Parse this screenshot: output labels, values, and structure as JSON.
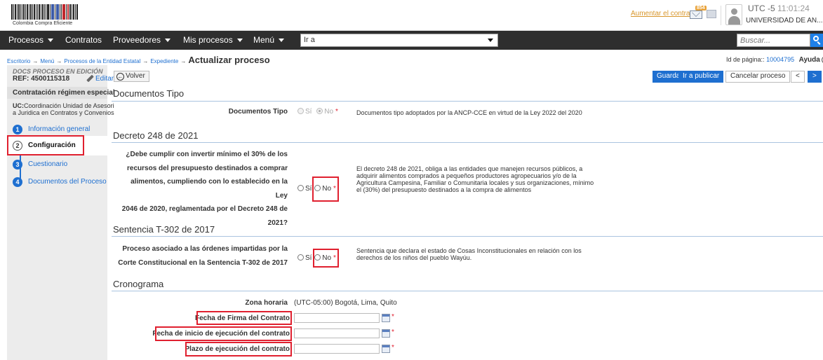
{
  "header": {
    "logo_text": "Colombia Compra Eficiente",
    "contrast_link": "Aumentar el contraste",
    "mail_badge": "854",
    "utc_label": "UTC -5",
    "utc_time": "11:01:24",
    "entity": "UNIVERSIDAD DE AN..."
  },
  "nav": {
    "items": [
      "Procesos",
      "Contratos",
      "Proveedores",
      "Mis procesos",
      "Menú"
    ],
    "goto_value": "Ir a",
    "search_placeholder": "Buscar..."
  },
  "breadcrumb": {
    "items": [
      "Escritorio",
      "Menú",
      "Procesos de la Entidad Estatal",
      "Expediente"
    ],
    "separator": "→",
    "current": "Actualizar proceso",
    "page_id_label": "Id de página::",
    "page_id_value": "10004795",
    "help_label": "Ayuda",
    "help_glyph": "?"
  },
  "sidebar": {
    "status": "DOCS PROCESO EN EDICIÓN",
    "ref": "REF: 4500115318",
    "edit_label": "Editar",
    "regimen": "Contratación régimen especial",
    "uc_label": "UC:",
    "uc_line1": "Coordinación Unidad de Asesori",
    "uc_line2": "a Juridica en Contratos y Convenios",
    "steps": [
      {
        "num": "1",
        "label": "Información general"
      },
      {
        "num": "2",
        "label": "Configuración"
      },
      {
        "num": "3",
        "label": "Cuestionario"
      },
      {
        "num": "4",
        "label": "Documentos del Proceso"
      }
    ]
  },
  "toolbar": {
    "back_label": "Volver",
    "save_label": "Guardar",
    "publish_label": "Ir a publicar",
    "cancel_label": "Cancelar proceso",
    "prev_label": "<",
    "next_label": ">"
  },
  "form": {
    "yes_label": "Sí",
    "no_label": "No",
    "required_mark": "*",
    "docs_tipo": {
      "title": "Documentos Tipo",
      "field_label": "Documentos Tipo",
      "description": "Documentos tipo adoptados por la ANCP-CCE en virtud de la Ley 2022 del 2020"
    },
    "decreto": {
      "title": "Decreto 248 de 2021",
      "question_lines": [
        "¿Debe cumplir con invertir mínimo el 30% de los",
        "recursos del presupuesto destinados a comprar",
        "alimentos, cumpliendo con lo establecido en la Ley",
        "2046 de 2020, reglamentada por el Decreto 248 de",
        "2021?"
      ],
      "description_lines": [
        "El decreto 248 de 2021, obliga a las entidades que manejen recursos públicos, a",
        "adquirir alimentos comprados a pequeños productores agropecuarios y/o de la",
        "Agricultura Campesina, Familiar o Comunitaria locales y sus organizaciones, mínimo",
        "el (30%) del presupuesto destinados a la compra de alimentos"
      ]
    },
    "sentencia": {
      "title": "Sentencia T-302 de 2017",
      "question_lines": [
        "Proceso asociado a las órdenes impartidas por la",
        "Corte Constitucional en la Sentencia T-302 de 2017"
      ],
      "description_lines": [
        "Sentencia que declara el estado de Cosas Inconstitucionales en relación con los",
        "derechos de los niños del pueblo Wayúu."
      ]
    },
    "cronograma": {
      "title": "Cronograma",
      "timezone_label": "Zona horaria",
      "timezone_value": "(UTC-05:00) Bogotá, Lima, Quito",
      "fecha_firma_label": "Fecha de Firma del Contrato",
      "fecha_inicio_label": "Fecha de inicio de ejecución del contrato",
      "plazo_label": "Plazo de ejecución del contrato"
    }
  }
}
